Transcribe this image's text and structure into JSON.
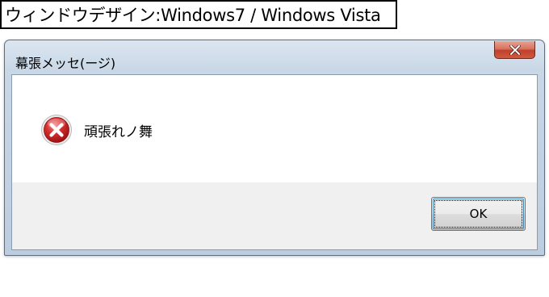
{
  "caption": {
    "text": "ウィンドウデザイン:Windows7 / Windows Vista"
  },
  "window": {
    "title": "幕張メッセ(ージ)",
    "close_button": "close",
    "message": "頑張れノ舞",
    "icon": "error-icon",
    "ok_label": "OK"
  },
  "colors": {
    "close_red": "#c0402b",
    "icon_red": "#c41f1f",
    "frame_blue": "#bccddf"
  }
}
